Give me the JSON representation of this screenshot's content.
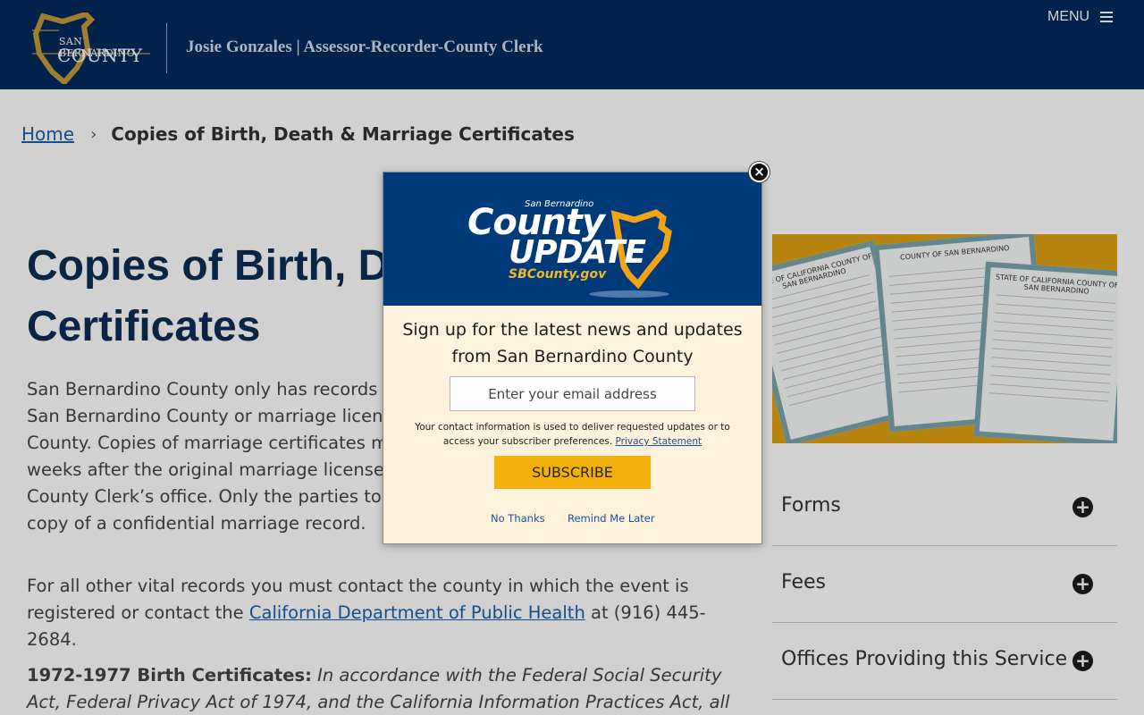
{
  "header": {
    "logo_line1": "SAN BERNARDINO",
    "logo_line2": "COUNTY",
    "title": "Josie Gonzales | Assessor-Recorder-County Clerk",
    "menu_label": "MENU"
  },
  "breadcrumb": {
    "home": "Home",
    "separator": "›",
    "current": "Copies of Birth, Death & Marriage Certificates"
  },
  "main": {
    "title": "Copies of Birth, Death & Marriage Certificates",
    "para1": "San Bernardino County only has records of births and deaths that occurred in San Bernardino County or marriage licenses that were issued in San Bernardino County. Copies of marriage certificates may be obtained approximately two weeks after the original marriage license is returned to the Assessor-Recorder-County Clerk’s office. Only the parties to the marriage may obtain a certified copy of a confidential marriage record.",
    "para2_prefix": "For all other vital records you must contact the county in which the event is registered or contact the ",
    "para2_link": "California Department of Public Health",
    "para2_suffix": " at (916) 445-2684.",
    "para3_bold": "1972-1977 Birth Certificates:",
    "para3_italic": " In accordance with the Federal Social Security Act, Federal Privacy Act of 1974, and the California Information Practices Act, all social"
  },
  "sidebar": {
    "image_certs": [
      {
        "head": "STATE OF CALIFORNIA\nCOUNTY OF SAN BERNARDINO"
      },
      {
        "head": "COUNTY OF SAN BERNARDINO"
      },
      {
        "head": "STATE OF CALIFORNIA\nCOUNTY OF SAN BERNARDINO"
      }
    ],
    "accordions": [
      {
        "label": "Forms",
        "icon": "+"
      },
      {
        "label": "Fees",
        "icon": "+"
      },
      {
        "label": "Offices Providing this Service",
        "icon": "+"
      }
    ]
  },
  "modal": {
    "banner_small": "San Bernardino",
    "banner_county": "County",
    "banner_update": "UPDATE",
    "banner_url": "SBCounty.gov",
    "heading": "Sign up for the latest news and updates from San Bernardino County",
    "email_placeholder": "Enter your email address",
    "notice_text": "Your contact information is used to deliver requested updates or to access your subscriber preferences.",
    "privacy_link": "Privacy Statement",
    "subscribe_label": "SUBSCRIBE",
    "no_thanks": "No Thanks",
    "remind_later": "Remind Me Later",
    "close_icon": "×"
  },
  "colors": {
    "header_bg": "#002a5c",
    "modal_banner_bg": "#003a78",
    "subscribe_bg": "#f4b00a",
    "modal_bg": "#fdf2dc",
    "title_color": "#0d2d55",
    "link_color": "#1a5fa8"
  }
}
